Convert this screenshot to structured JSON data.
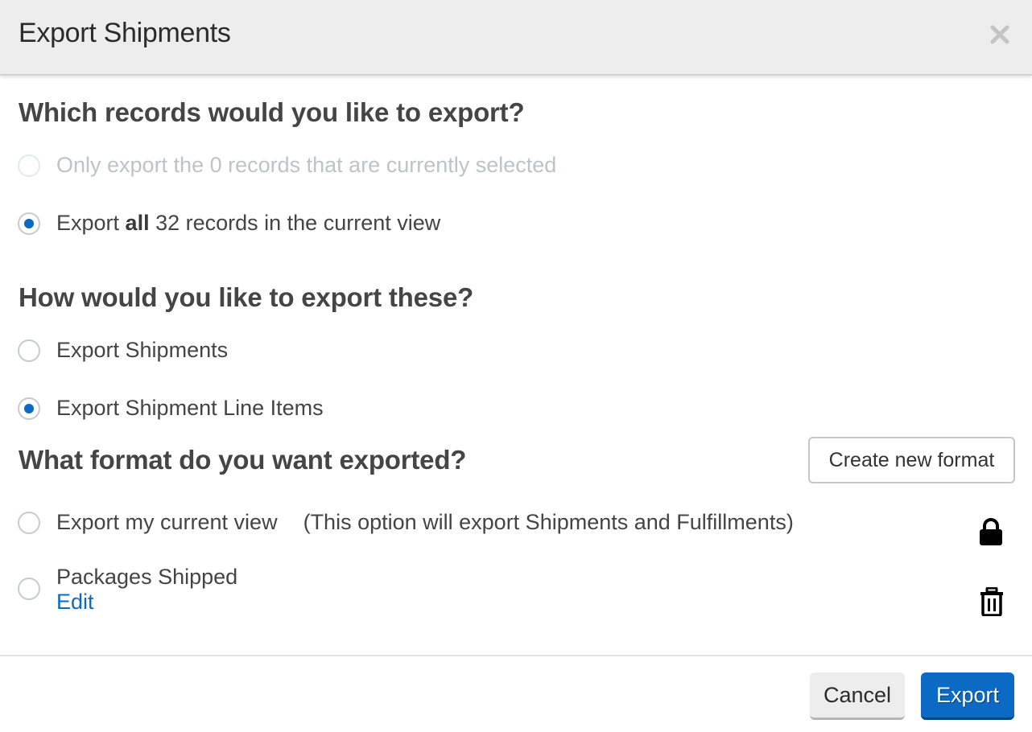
{
  "dialog": {
    "title": "Export Shipments",
    "close_icon": "close-icon"
  },
  "records_section": {
    "title": "Which records would you like to export?",
    "options": [
      {
        "label": "Only export the 0 records that are currently selected",
        "selected": false,
        "disabled": true
      },
      {
        "label_prefix": "Export ",
        "label_bold": "all",
        "label_suffix": " 32 records in the current view",
        "selected": true,
        "disabled": false
      }
    ]
  },
  "how_section": {
    "title": "How would you like to export these?",
    "options": [
      {
        "label": "Export Shipments",
        "selected": false
      },
      {
        "label": "Export Shipment Line Items",
        "selected": true
      }
    ]
  },
  "format_section": {
    "title": "What format do you want exported?",
    "create_button": "Create new format",
    "options": [
      {
        "label": "Export my current view",
        "note": "(This option will export Shipments and Fulfillments)",
        "selected": false,
        "icon": "lock-icon"
      },
      {
        "label": "Packages Shipped",
        "edit_link": "Edit",
        "selected": false,
        "icon": "trash-icon"
      }
    ]
  },
  "footer": {
    "cancel_label": "Cancel",
    "export_label": "Export"
  },
  "colors": {
    "accent": "#0a6ac4",
    "header_bg": "#ededed",
    "text": "#444444",
    "disabled_text": "#bcc4c9"
  }
}
